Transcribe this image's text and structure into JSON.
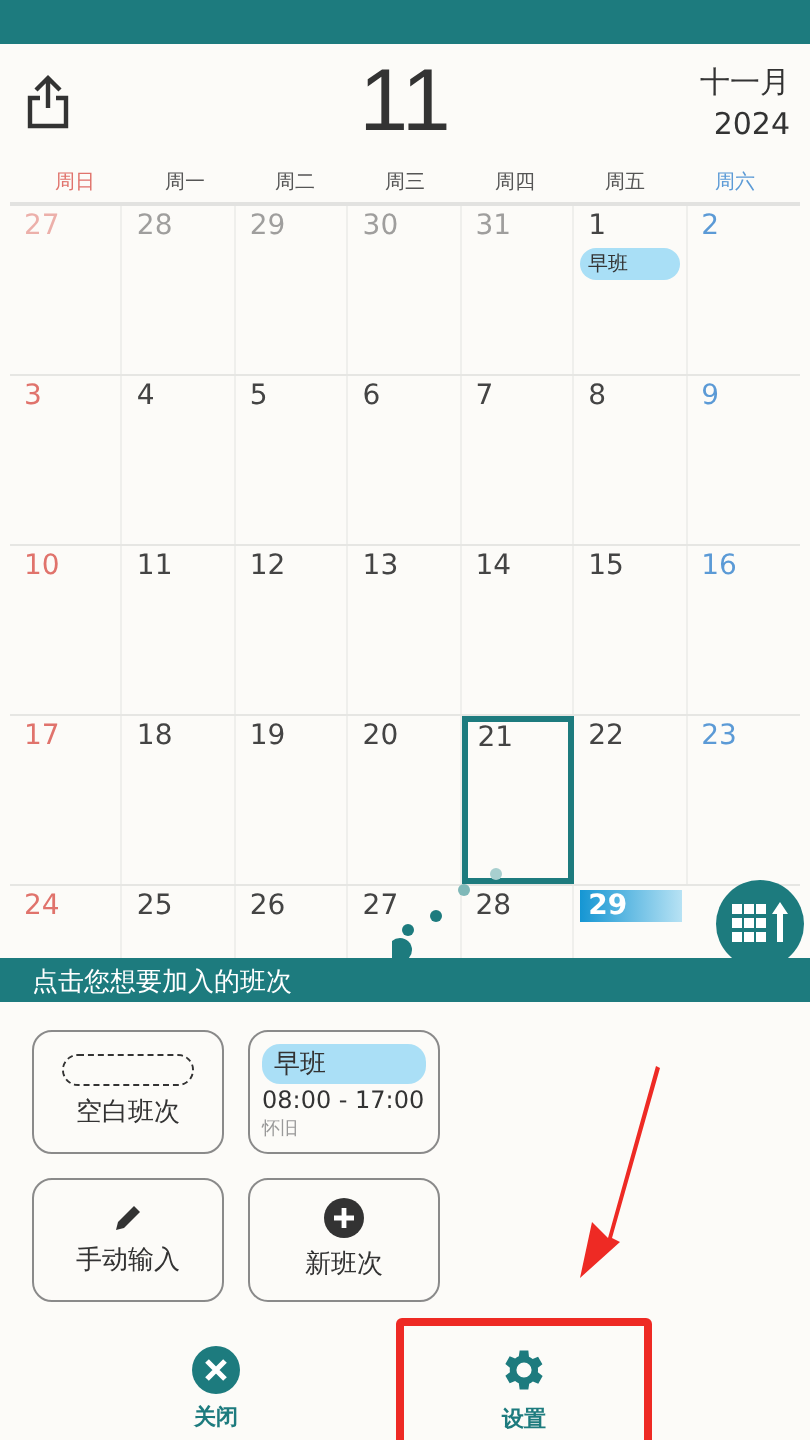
{
  "header": {
    "month_number": "11",
    "month_name": "十一月",
    "year": "2024"
  },
  "weekdays": [
    {
      "label": "周日",
      "kind": "sunday"
    },
    {
      "label": "周一",
      "kind": "weekday"
    },
    {
      "label": "周二",
      "kind": "weekday"
    },
    {
      "label": "周三",
      "kind": "weekday"
    },
    {
      "label": "周四",
      "kind": "weekday"
    },
    {
      "label": "周五",
      "kind": "weekday"
    },
    {
      "label": "周六",
      "kind": "saturday"
    }
  ],
  "weeks": [
    [
      {
        "label": "27",
        "muted": true,
        "selected": false,
        "today": false
      },
      {
        "label": "28",
        "muted": true,
        "selected": false,
        "today": false
      },
      {
        "label": "29",
        "muted": true,
        "selected": false,
        "today": false
      },
      {
        "label": "30",
        "muted": true,
        "selected": false,
        "today": false
      },
      {
        "label": "31",
        "muted": true,
        "selected": false,
        "today": false
      },
      {
        "label": "1",
        "muted": false,
        "selected": false,
        "today": false,
        "shift": "早班"
      },
      {
        "label": "2",
        "muted": false,
        "selected": false,
        "today": false
      }
    ],
    [
      {
        "label": "3",
        "muted": false,
        "selected": false,
        "today": false
      },
      {
        "label": "4",
        "muted": false,
        "selected": false,
        "today": false
      },
      {
        "label": "5",
        "muted": false,
        "selected": false,
        "today": false
      },
      {
        "label": "6",
        "muted": false,
        "selected": false,
        "today": false
      },
      {
        "label": "7",
        "muted": false,
        "selected": false,
        "today": false
      },
      {
        "label": "8",
        "muted": false,
        "selected": false,
        "today": false
      },
      {
        "label": "9",
        "muted": false,
        "selected": false,
        "today": false
      }
    ],
    [
      {
        "label": "10",
        "muted": false,
        "selected": false,
        "today": false
      },
      {
        "label": "11",
        "muted": false,
        "selected": false,
        "today": false
      },
      {
        "label": "12",
        "muted": false,
        "selected": false,
        "today": false
      },
      {
        "label": "13",
        "muted": false,
        "selected": false,
        "today": false
      },
      {
        "label": "14",
        "muted": false,
        "selected": false,
        "today": false
      },
      {
        "label": "15",
        "muted": false,
        "selected": false,
        "today": false
      },
      {
        "label": "16",
        "muted": false,
        "selected": false,
        "today": false
      }
    ],
    [
      {
        "label": "17",
        "muted": false,
        "selected": false,
        "today": false
      },
      {
        "label": "18",
        "muted": false,
        "selected": false,
        "today": false
      },
      {
        "label": "19",
        "muted": false,
        "selected": false,
        "today": false
      },
      {
        "label": "20",
        "muted": false,
        "selected": false,
        "today": false
      },
      {
        "label": "21",
        "muted": false,
        "selected": false,
        "today": true
      },
      {
        "label": "22",
        "muted": false,
        "selected": false,
        "today": false
      },
      {
        "label": "23",
        "muted": false,
        "selected": false,
        "today": false
      }
    ],
    [
      {
        "label": "24",
        "muted": false,
        "selected": false,
        "today": false
      },
      {
        "label": "25",
        "muted": false,
        "selected": false,
        "today": false
      },
      {
        "label": "26",
        "muted": false,
        "selected": false,
        "today": false
      },
      {
        "label": "27",
        "muted": false,
        "selected": false,
        "today": false
      },
      {
        "label": "28",
        "muted": false,
        "selected": false,
        "today": false
      },
      {
        "label": "29",
        "muted": false,
        "selected": true,
        "today": false
      }
    ]
  ],
  "banner": "点击您想要加入的班次",
  "option_rows": [
    {
      "options": [
        {
          "kind": "blank",
          "label": "空白班次"
        },
        {
          "kind": "shift",
          "name": "早班",
          "time": "08:00 - 17:00",
          "note": "怀旧"
        }
      ]
    },
    {
      "options": [
        {
          "kind": "manual",
          "label": "手动输入"
        },
        {
          "kind": "new",
          "label": "新班次"
        }
      ]
    }
  ],
  "actions": [
    {
      "kind": "close",
      "label": "关闭",
      "highlighted": false
    },
    {
      "kind": "settings",
      "label": "设置",
      "highlighted": true
    }
  ]
}
